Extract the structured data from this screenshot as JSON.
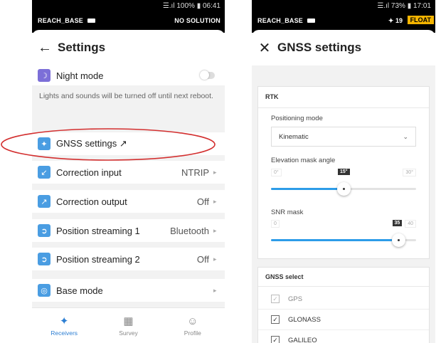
{
  "left": {
    "status": {
      "signal": "☰.ıl 100% ▮ 06:41",
      "device": "REACH_BASE",
      "solution": "NO SOLUTION"
    },
    "appbar": {
      "back_icon": "arrow-left-icon",
      "title": "Settings"
    },
    "night_mode": {
      "label": "Night mode",
      "note": "Lights and sounds will be turned off until next reboot."
    },
    "items": [
      {
        "icon": "satellite-icon",
        "label": "GNSS settings ↗",
        "value": ""
      },
      {
        "icon": "correction-input-icon",
        "label": "Correction input",
        "value": "NTRIP"
      },
      {
        "icon": "correction-output-icon",
        "label": "Correction output",
        "value": "Off"
      },
      {
        "icon": "position-streaming-icon",
        "label": "Position streaming 1",
        "value": "Bluetooth"
      },
      {
        "icon": "position-streaming-icon",
        "label": "Position streaming 2",
        "value": "Off"
      },
      {
        "icon": "base-mode-icon",
        "label": "Base mode",
        "value": ""
      }
    ],
    "tabs": [
      {
        "label": "Receivers",
        "icon": "satellite-icon",
        "active": true
      },
      {
        "label": "Survey",
        "icon": "map-icon",
        "active": false
      },
      {
        "label": "Profile",
        "icon": "person-icon",
        "active": false
      }
    ],
    "annotation_color": "#d32f2f"
  },
  "right": {
    "status": {
      "signal": "☰.ıl 73% ▮ 17:01",
      "device": "REACH_BASE",
      "satellites": "19",
      "solution": "FLOAT"
    },
    "appbar": {
      "close_icon": "close-icon",
      "title": "GNSS settings"
    },
    "rtk": {
      "title": "RTK",
      "positioning_mode": {
        "label": "Positioning mode",
        "value": "Kinematic"
      },
      "elevation_mask": {
        "label": "Elevation mask angle",
        "min": "0°",
        "max": "30°",
        "value": "15°",
        "fraction": 0.5
      },
      "snr_mask": {
        "label": "SNR mask",
        "min": "0",
        "max": "40",
        "value": "35",
        "fraction": 0.875
      }
    },
    "gnss_select": {
      "title": "GNSS select",
      "systems": [
        {
          "label": "GPS",
          "checked": true,
          "enabled": false
        },
        {
          "label": "GLONASS",
          "checked": true,
          "enabled": true
        },
        {
          "label": "GALILEO",
          "checked": true,
          "enabled": true
        }
      ]
    }
  },
  "colors": {
    "accent": "#2d9ce8",
    "float_badge": "#f4b400",
    "tab_active": "#2d7fd3"
  }
}
